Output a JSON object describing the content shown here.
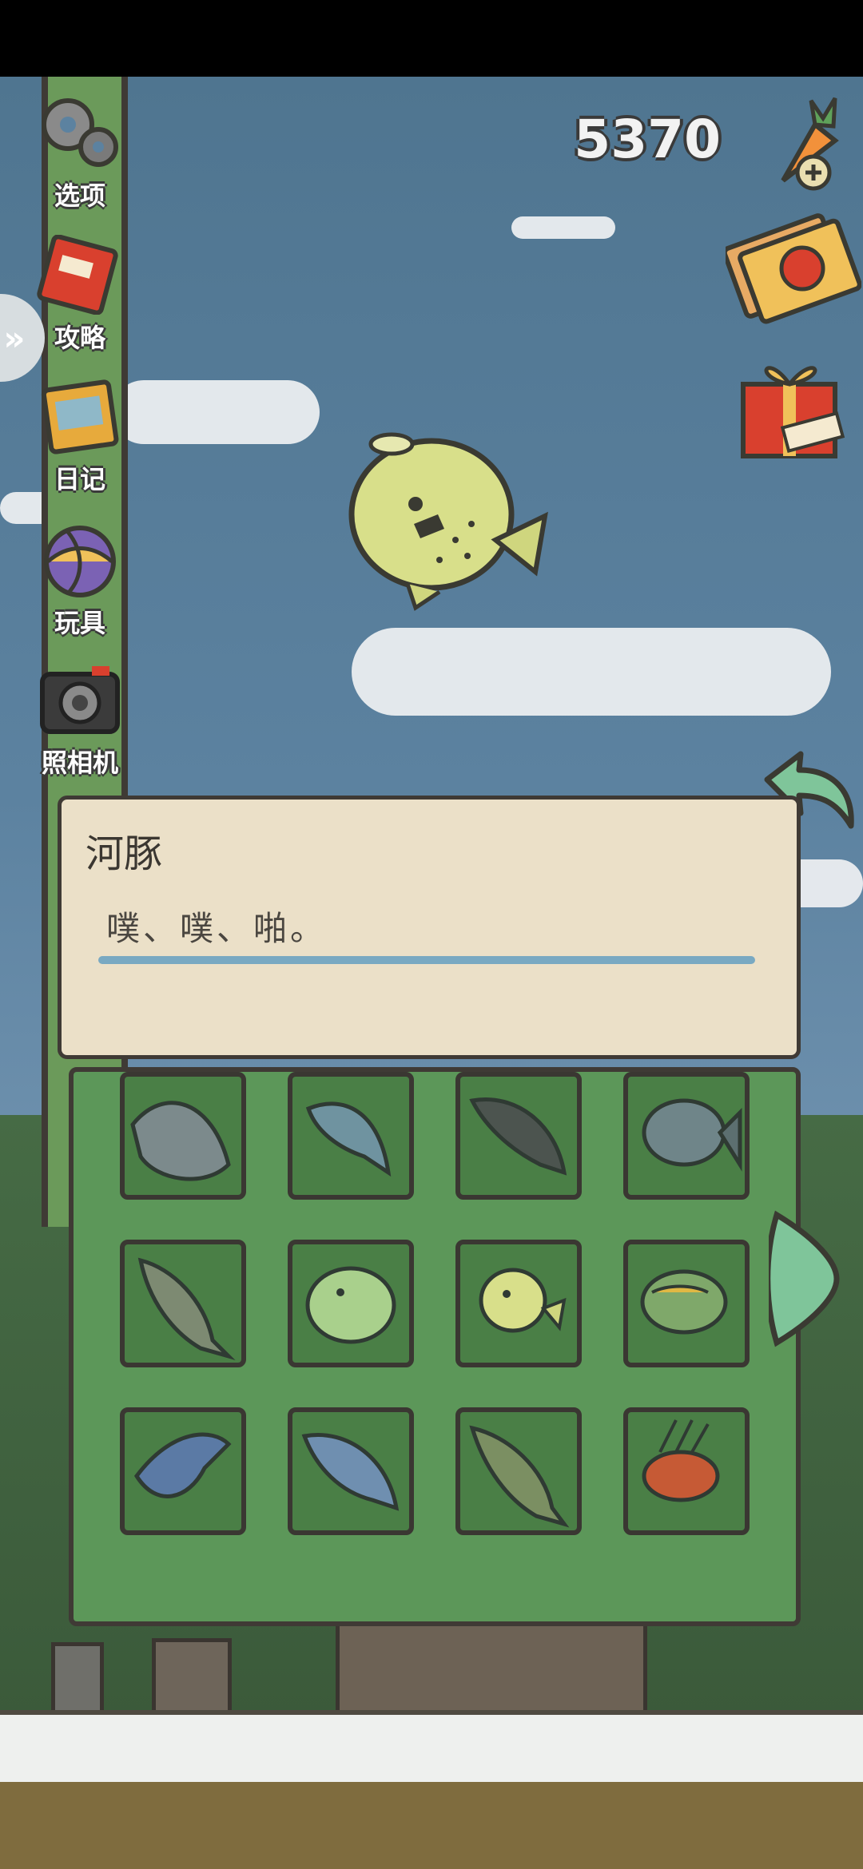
{
  "currency": {
    "amount": "5370"
  },
  "sidebar": {
    "items": [
      {
        "label": "选项",
        "icon": "gear-icon"
      },
      {
        "label": "攻略",
        "icon": "guide-book-icon"
      },
      {
        "label": "日记",
        "icon": "diary-icon"
      },
      {
        "label": "玩具",
        "icon": "toy-ball-icon"
      },
      {
        "label": "照相机",
        "icon": "camera-icon"
      }
    ]
  },
  "dialog": {
    "title": "河豚",
    "text": "噗、噗、啪。"
  },
  "colors": {
    "panel_green": "#5c9759",
    "cell_green": "#4a7f46",
    "dialog_bg": "#ebe0c8",
    "sky": "#5c82a0"
  },
  "fish_grid": [
    [
      "sturgeon-icon",
      "fish-icon",
      "catfish-icon",
      "piranha-icon"
    ],
    [
      "bass-icon",
      "green-pufferfish-icon",
      "pufferfish-icon",
      "sunfish-icon"
    ],
    [
      "flying-fish-icon",
      "salmon-icon",
      "largemouth-bass-icon",
      "lionfish-icon"
    ]
  ]
}
